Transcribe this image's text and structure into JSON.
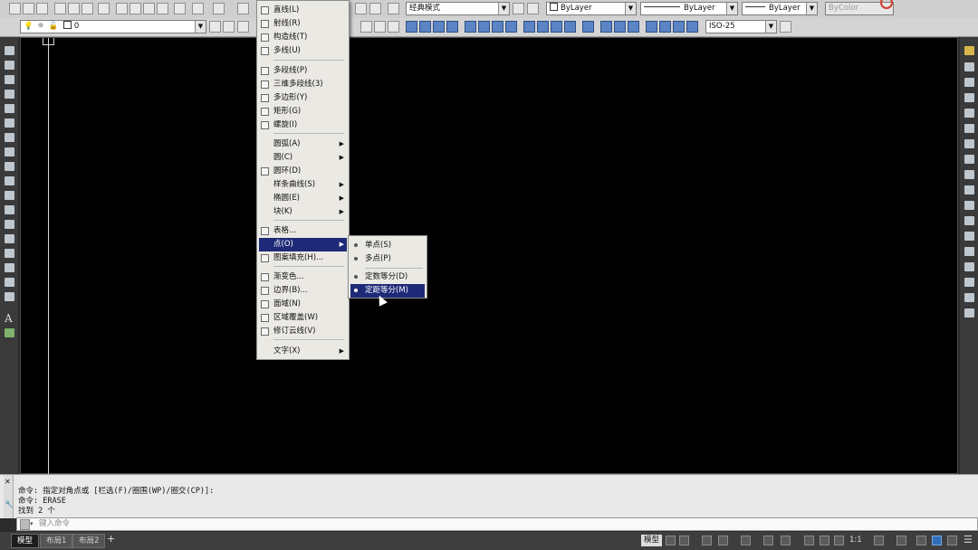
{
  "toolbar_top": {
    "workspace": "经典模式",
    "color": "ByLayer",
    "linetype": "ByLayer",
    "lineweight": "ByLayer",
    "plotstyle": "ByColor"
  },
  "toolbar_second": {
    "layer": "0",
    "dimstyle": "ISO-25"
  },
  "draw_menu": {
    "items": [
      {
        "label": "直线(L)",
        "icon": "line-icon"
      },
      {
        "label": "射线(R)",
        "icon": "ray-icon"
      },
      {
        "label": "构造线(T)",
        "icon": "xline-icon"
      },
      {
        "label": "多线(U)",
        "icon": "mline-icon"
      },
      {
        "label": "多段线(P)",
        "icon": "polyline-icon"
      },
      {
        "label": "三维多段线(3)",
        "icon": "3dpoly-icon"
      },
      {
        "label": "多边形(Y)",
        "icon": "polygon-icon"
      },
      {
        "label": "矩形(G)",
        "icon": "rectangle-icon"
      },
      {
        "label": "螺旋(I)",
        "icon": "helix-icon"
      },
      {
        "label": "圆弧(A)",
        "submenu": true
      },
      {
        "label": "圆(C)",
        "submenu": true
      },
      {
        "label": "圆环(D)",
        "icon": "donut-icon"
      },
      {
        "label": "样条曲线(S)",
        "submenu": true
      },
      {
        "label": "椭圆(E)",
        "submenu": true
      },
      {
        "label": "块(K)",
        "submenu": true
      },
      {
        "label": "表格...",
        "icon": "table-icon"
      },
      {
        "label": "点(O)",
        "submenu": true,
        "highlighted": true
      },
      {
        "label": "图案填充(H)...",
        "icon": "hatch-icon"
      },
      {
        "label": "渐变色...",
        "icon": "gradient-icon"
      },
      {
        "label": "边界(B)...",
        "icon": "boundary-icon"
      },
      {
        "label": "面域(N)",
        "icon": "region-icon"
      },
      {
        "label": "区域覆盖(W)",
        "icon": "wipeout-icon"
      },
      {
        "label": "修订云线(V)",
        "icon": "revcloud-icon"
      },
      {
        "label": "文字(X)",
        "submenu": true
      }
    ]
  },
  "point_submenu": {
    "items": [
      {
        "label": "单点(S)"
      },
      {
        "label": "多点(P)"
      },
      {
        "label": "定数等分(D)"
      },
      {
        "label": "定距等分(M)",
        "highlighted": true
      }
    ]
  },
  "command": {
    "history": [
      "命令: 指定对角点或 [栏选(F)/圈围(WP)/圈交(CP)]:",
      "命令:  ERASE",
      "找到 2 个"
    ],
    "input_placeholder": "键入命令"
  },
  "status_bar": {
    "tabs": [
      "模型",
      "布局1",
      "布局2"
    ],
    "active_tab": "模型",
    "model_label": "模型",
    "scale": "1:1"
  },
  "colors": {
    "canvas": "#000000",
    "highlight": "#1e2a78",
    "menu_bg": "#ebe9e4"
  }
}
